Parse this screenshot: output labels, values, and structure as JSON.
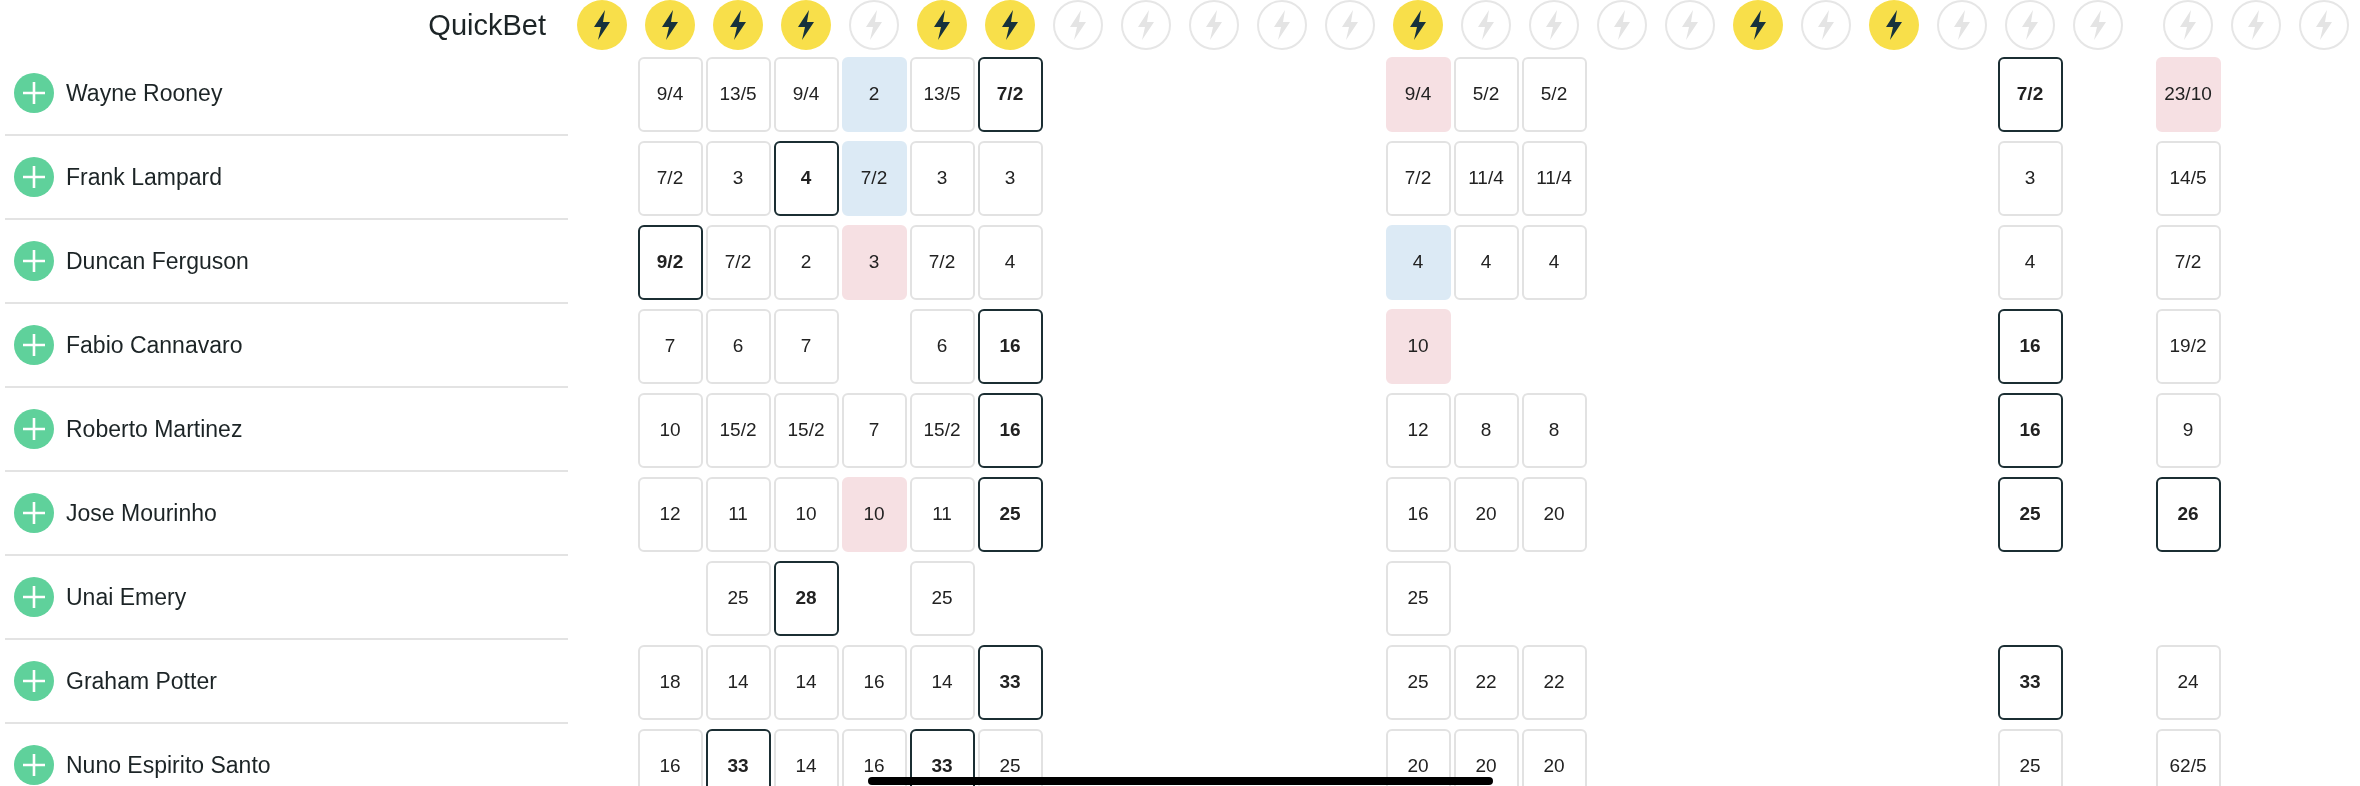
{
  "quickbet": {
    "label": "QuickBet",
    "buttons": [
      {
        "on": true
      },
      {
        "on": true
      },
      {
        "on": true
      },
      {
        "on": true
      },
      {
        "on": false
      },
      {
        "on": true
      },
      {
        "on": true
      },
      {
        "on": false
      },
      {
        "on": false
      },
      {
        "on": false
      },
      {
        "on": false
      },
      {
        "on": false
      },
      {
        "on": true
      },
      {
        "on": false
      },
      {
        "on": false
      },
      {
        "on": false
      },
      {
        "on": false
      },
      {
        "on": true
      },
      {
        "on": false
      },
      {
        "on": true
      },
      {
        "on": false
      },
      {
        "on": false
      },
      {
        "on": false
      },
      {
        "on": false
      },
      {
        "on": false
      },
      {
        "on": false
      }
    ]
  },
  "rows": [
    {
      "name": "Wayne Rooney",
      "odds": {
        "column_2": {
          "text": "9/4",
          "kind": "plain"
        },
        "column_3": {
          "text": "13/5",
          "kind": "plain"
        },
        "column_4": {
          "text": "9/4",
          "kind": "plain"
        },
        "column_5": {
          "text": "2",
          "kind": "shortened"
        },
        "column_6": {
          "text": "13/5",
          "kind": "plain"
        },
        "column_7": {
          "text": "7/2",
          "kind": "best"
        },
        "column_13": {
          "text": "9/4",
          "kind": "drifted"
        },
        "column_14": {
          "text": "5/2",
          "kind": "plain"
        },
        "column_15": {
          "text": "5/2",
          "kind": "plain"
        },
        "column_22": {
          "text": "7/2",
          "kind": "best"
        },
        "column_24": {
          "text": "23/10",
          "kind": "drifted"
        }
      }
    },
    {
      "name": "Frank Lampard",
      "odds": {
        "column_2": {
          "text": "7/2",
          "kind": "plain"
        },
        "column_3": {
          "text": "3",
          "kind": "plain"
        },
        "column_4": {
          "text": "4",
          "kind": "best"
        },
        "column_5": {
          "text": "7/2",
          "kind": "shortened"
        },
        "column_6": {
          "text": "3",
          "kind": "plain"
        },
        "column_7": {
          "text": "3",
          "kind": "plain"
        },
        "column_13": {
          "text": "7/2",
          "kind": "plain"
        },
        "column_14": {
          "text": "11/4",
          "kind": "plain"
        },
        "column_15": {
          "text": "11/4",
          "kind": "plain"
        },
        "column_22": {
          "text": "3",
          "kind": "plain"
        },
        "column_24": {
          "text": "14/5",
          "kind": "plain"
        }
      }
    },
    {
      "name": "Duncan Ferguson",
      "odds": {
        "column_2": {
          "text": "9/2",
          "kind": "best"
        },
        "column_3": {
          "text": "7/2",
          "kind": "plain"
        },
        "column_4": {
          "text": "2",
          "kind": "plain"
        },
        "column_5": {
          "text": "3",
          "kind": "drifted"
        },
        "column_6": {
          "text": "7/2",
          "kind": "plain"
        },
        "column_7": {
          "text": "4",
          "kind": "plain"
        },
        "column_13": {
          "text": "4",
          "kind": "shortened"
        },
        "column_14": {
          "text": "4",
          "kind": "plain"
        },
        "column_15": {
          "text": "4",
          "kind": "plain"
        },
        "column_22": {
          "text": "4",
          "kind": "plain"
        },
        "column_24": {
          "text": "7/2",
          "kind": "plain"
        }
      }
    },
    {
      "name": "Fabio Cannavaro",
      "odds": {
        "column_2": {
          "text": "7",
          "kind": "plain"
        },
        "column_3": {
          "text": "6",
          "kind": "plain"
        },
        "column_4": {
          "text": "7",
          "kind": "plain"
        },
        "column_6": {
          "text": "6",
          "kind": "plain"
        },
        "column_7": {
          "text": "16",
          "kind": "best"
        },
        "column_13": {
          "text": "10",
          "kind": "drifted"
        },
        "column_22": {
          "text": "16",
          "kind": "best"
        },
        "column_24": {
          "text": "19/2",
          "kind": "plain"
        }
      }
    },
    {
      "name": "Roberto Martinez",
      "odds": {
        "column_2": {
          "text": "10",
          "kind": "plain"
        },
        "column_3": {
          "text": "15/2",
          "kind": "plain"
        },
        "column_4": {
          "text": "15/2",
          "kind": "plain"
        },
        "column_5": {
          "text": "7",
          "kind": "plain"
        },
        "column_6": {
          "text": "15/2",
          "kind": "plain"
        },
        "column_7": {
          "text": "16",
          "kind": "best"
        },
        "column_13": {
          "text": "12",
          "kind": "plain"
        },
        "column_14": {
          "text": "8",
          "kind": "plain"
        },
        "column_15": {
          "text": "8",
          "kind": "plain"
        },
        "column_22": {
          "text": "16",
          "kind": "best"
        },
        "column_24": {
          "text": "9",
          "kind": "plain"
        }
      }
    },
    {
      "name": "Jose Mourinho",
      "odds": {
        "column_2": {
          "text": "12",
          "kind": "plain"
        },
        "column_3": {
          "text": "11",
          "kind": "plain"
        },
        "column_4": {
          "text": "10",
          "kind": "plain"
        },
        "column_5": {
          "text": "10",
          "kind": "drifted"
        },
        "column_6": {
          "text": "11",
          "kind": "plain"
        },
        "column_7": {
          "text": "25",
          "kind": "best"
        },
        "column_13": {
          "text": "16",
          "kind": "plain"
        },
        "column_14": {
          "text": "20",
          "kind": "plain"
        },
        "column_15": {
          "text": "20",
          "kind": "plain"
        },
        "column_22": {
          "text": "25",
          "kind": "best"
        },
        "column_24": {
          "text": "26",
          "kind": "best"
        }
      }
    },
    {
      "name": "Unai Emery",
      "odds": {
        "column_3": {
          "text": "25",
          "kind": "plain"
        },
        "column_4": {
          "text": "28",
          "kind": "best"
        },
        "column_6": {
          "text": "25",
          "kind": "plain"
        },
        "column_13": {
          "text": "25",
          "kind": "plain"
        }
      }
    },
    {
      "name": "Graham Potter",
      "odds": {
        "column_2": {
          "text": "18",
          "kind": "plain"
        },
        "column_3": {
          "text": "14",
          "kind": "plain"
        },
        "column_4": {
          "text": "14",
          "kind": "plain"
        },
        "column_5": {
          "text": "16",
          "kind": "plain"
        },
        "column_6": {
          "text": "14",
          "kind": "plain"
        },
        "column_7": {
          "text": "33",
          "kind": "best"
        },
        "column_13": {
          "text": "25",
          "kind": "plain"
        },
        "column_14": {
          "text": "22",
          "kind": "plain"
        },
        "column_15": {
          "text": "22",
          "kind": "plain"
        },
        "column_22": {
          "text": "33",
          "kind": "best"
        },
        "column_24": {
          "text": "24",
          "kind": "plain"
        }
      }
    },
    {
      "name": "Nuno Espirito Santo",
      "odds": {
        "column_2": {
          "text": "16",
          "kind": "plain"
        },
        "column_3": {
          "text": "33",
          "kind": "best"
        },
        "column_4": {
          "text": "14",
          "kind": "plain"
        },
        "column_5": {
          "text": "16",
          "kind": "plain"
        },
        "column_6": {
          "text": "33",
          "kind": "best"
        },
        "column_7": {
          "text": "25",
          "kind": "plain"
        },
        "column_13": {
          "text": "20",
          "kind": "plain"
        },
        "column_14": {
          "text": "20",
          "kind": "plain"
        },
        "column_15": {
          "text": "20",
          "kind": "plain"
        },
        "column_22": {
          "text": "25",
          "kind": "plain"
        },
        "column_24": {
          "text": "62/5",
          "kind": "plain"
        }
      }
    }
  ]
}
